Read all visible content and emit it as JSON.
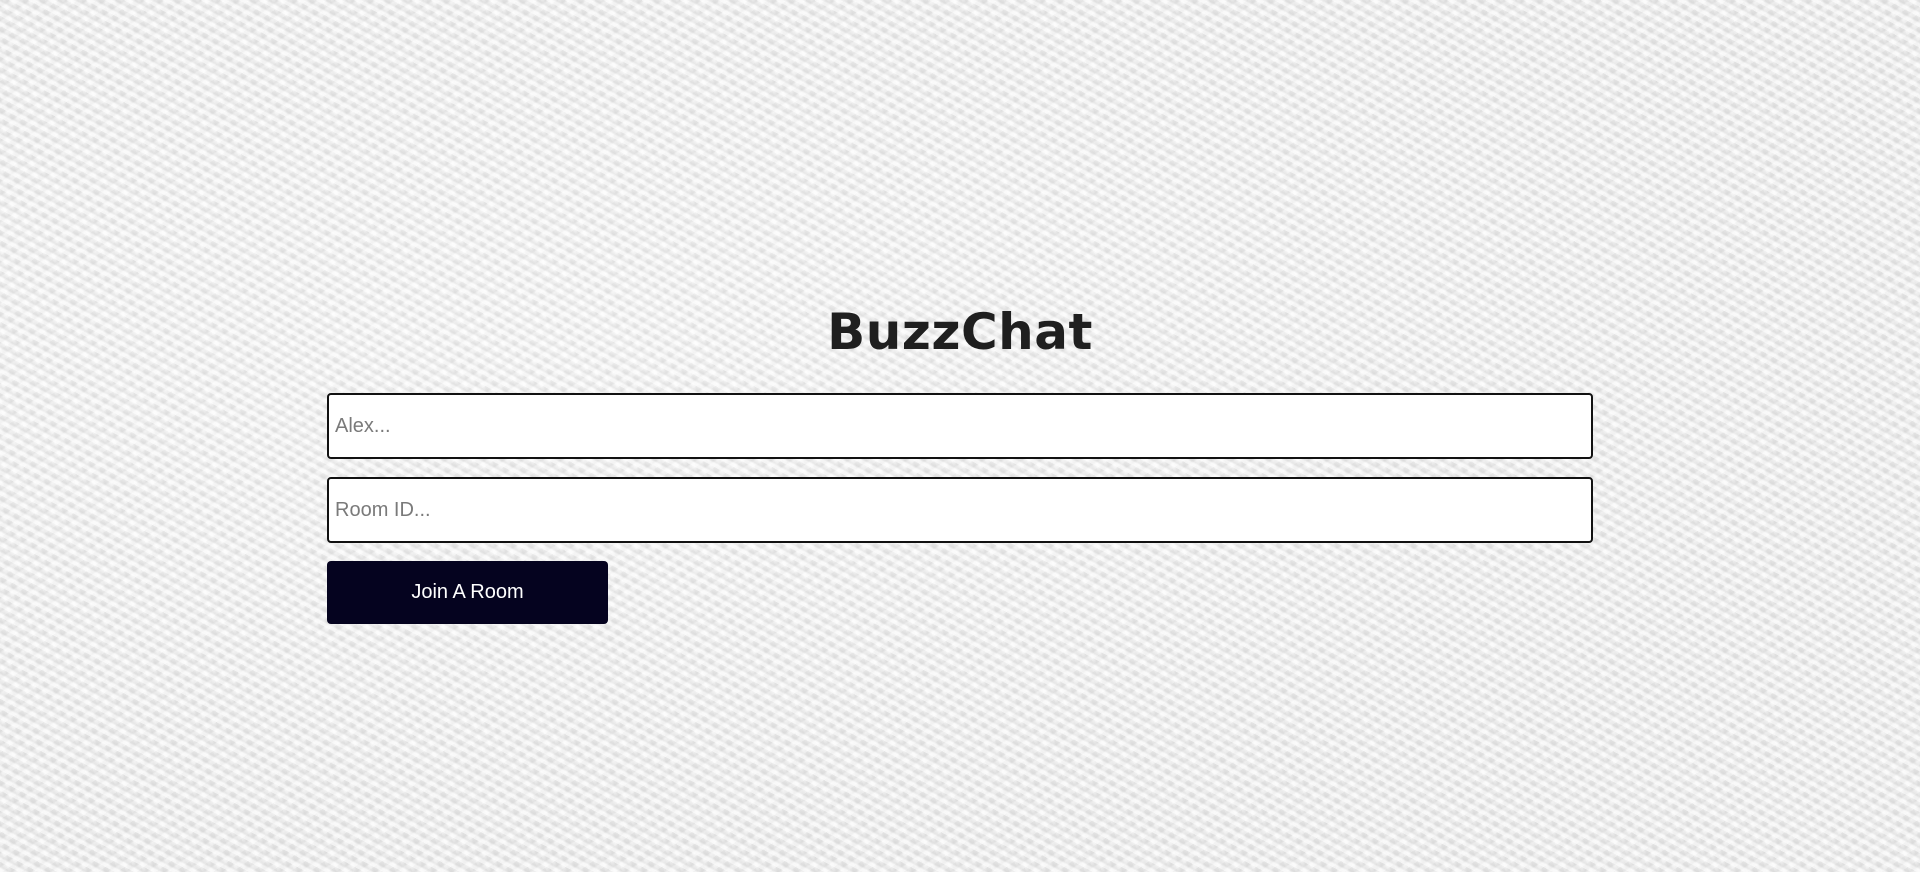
{
  "app": {
    "title": "BuzzChat"
  },
  "form": {
    "name_placeholder": "Alex...",
    "name_value": "",
    "room_placeholder": "Room ID...",
    "room_value": "",
    "join_label": "Join A Room"
  },
  "colors": {
    "button_bg": "#05031f",
    "button_text": "#ffffff",
    "title": "#1f1f1f",
    "input_border": "#111111"
  }
}
